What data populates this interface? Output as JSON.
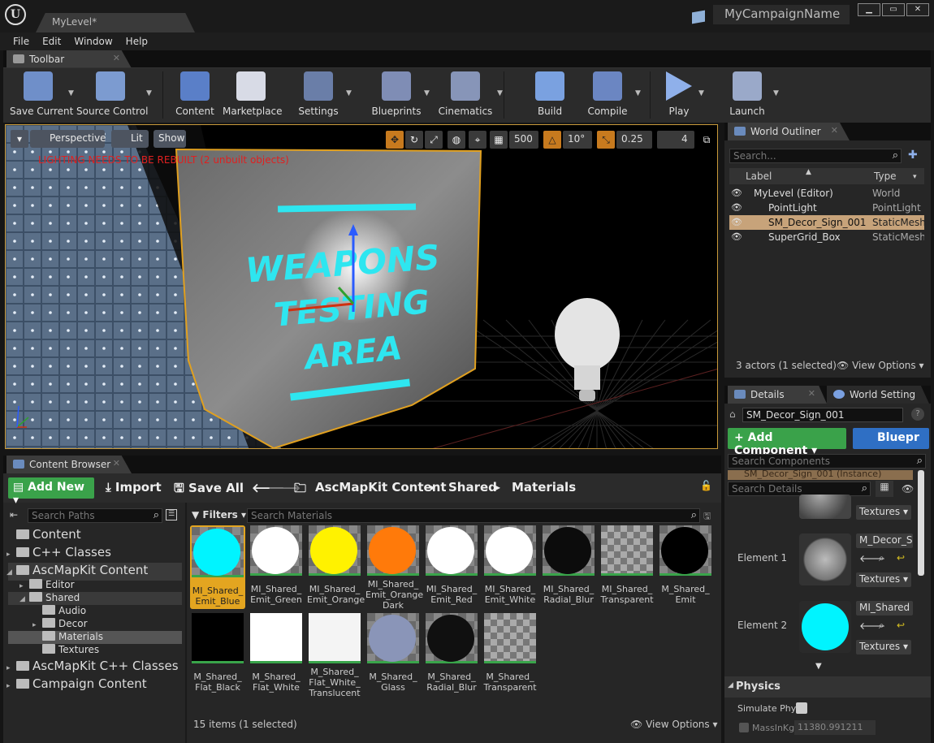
{
  "app": {
    "doc_tab": "MyLevel*",
    "campaign": "MyCampaignName",
    "win_buttons": [
      "▁",
      "▭",
      "✕"
    ]
  },
  "menu": [
    "File",
    "Edit",
    "Window",
    "Help"
  ],
  "toolbar_tab": "Toolbar",
  "toolbar": [
    {
      "label": "Save Current",
      "icon": "save-icon",
      "color": "#6f8fc9"
    },
    {
      "label": "Source Control",
      "icon": "source-control-icon",
      "color": "#7c9bd0"
    },
    {
      "label": "Content",
      "icon": "content-icon",
      "color": "#5a7fc8"
    },
    {
      "label": "Marketplace",
      "icon": "marketplace-icon",
      "color": "#d8dbe6"
    },
    {
      "label": "Settings",
      "icon": "settings-icon",
      "color": "#6a7ea8"
    },
    {
      "label": "Blueprints",
      "icon": "blueprints-icon",
      "color": "#7f8db5"
    },
    {
      "label": "Cinematics",
      "icon": "cinematics-icon",
      "color": "#8795b8"
    },
    {
      "label": "Build",
      "icon": "build-icon",
      "color": "#7aa1e0"
    },
    {
      "label": "Compile",
      "icon": "compile-icon",
      "color": "#6b86c2"
    },
    {
      "label": "Play",
      "icon": "play-icon",
      "color": "#8fb0ea"
    },
    {
      "label": "Launch",
      "icon": "launch-icon",
      "color": "#9aa9c9"
    }
  ],
  "viewport": {
    "perspective": "Perspective",
    "lit": "Lit",
    "show": "Show",
    "grid_snap": "500",
    "rot_snap": "10°",
    "scale_snap": "0.25",
    "cam_speed": "4",
    "warning": "LIGHTING NEEDS TO BE REBUILT (2 unbuilt objects)",
    "sign_lines": [
      "WEAPONS",
      "TESTING",
      "AREA"
    ]
  },
  "outliner": {
    "tab": "World Outliner",
    "search_placeholder": "Search...",
    "col_label": "Label",
    "col_type": "Type",
    "rows": [
      {
        "label": "MyLevel (Editor)",
        "type": "World",
        "indent": 0
      },
      {
        "label": "PointLight",
        "type": "PointLight",
        "indent": 1
      },
      {
        "label": "SM_Decor_Sign_001",
        "type": "StaticMeshActor",
        "indent": 1
      },
      {
        "label": "SuperGrid_Box",
        "type": "StaticMeshActor",
        "indent": 1
      }
    ],
    "status": "3 actors (1 selected)",
    "view_options": "View Options"
  },
  "details": {
    "tab": "Details",
    "tab2": "World Setting",
    "actor_name": "SM_Decor_Sign_001",
    "add_component": "+ Add Component",
    "blueprint": "Bluepr",
    "search_components": "Search Components",
    "component_row": "SM_Decor_Sign_001 (Instance)",
    "search_details": "Search Details",
    "textures": "Textures",
    "element1": "Element 1",
    "element1_mat": "M_Decor_S",
    "element2": "Element 2",
    "element2_mat": "MI_Shared",
    "physics": "Physics",
    "simulate": "Simulate Phy",
    "mass": "MassInKg",
    "mass_value": "11380.991211"
  },
  "content_browser": {
    "tab": "Content Browser",
    "add_new": "Add New",
    "import": "Import",
    "save_all": "Save All",
    "path": [
      "AscMapKit Content",
      "Shared",
      "Materials"
    ],
    "search_paths": "Search Paths",
    "filters": "Filters",
    "search_materials": "Search Materials",
    "tree": [
      {
        "label": "Content",
        "indent": 0,
        "big": true
      },
      {
        "label": "C++ Classes",
        "indent": 0,
        "big": true
      },
      {
        "label": "AscMapKit Content",
        "indent": 0,
        "big": true
      },
      {
        "label": "Editor",
        "indent": 1,
        "big": false
      },
      {
        "label": "Shared",
        "indent": 1,
        "big": false
      },
      {
        "label": "Audio",
        "indent": 2,
        "big": false
      },
      {
        "label": "Decor",
        "indent": 2,
        "big": false
      },
      {
        "label": "Materials",
        "indent": 2,
        "big": false
      },
      {
        "label": "Textures",
        "indent": 2,
        "big": false
      },
      {
        "label": "AscMapKit C++ Classes",
        "indent": 0,
        "big": true
      },
      {
        "label": "Campaign Content",
        "indent": 0,
        "big": true
      }
    ],
    "assets": [
      {
        "name": [
          "MI_Shared_",
          "Emit_Blue"
        ],
        "color": "#00f4ff",
        "kind": "ball"
      },
      {
        "name": [
          "MI_Shared_",
          "Emit_Green"
        ],
        "color": "#ffffff",
        "kind": "ball"
      },
      {
        "name": [
          "MI_Shared_",
          "Emit_Orange"
        ],
        "color": "#fff200",
        "kind": "ball"
      },
      {
        "name": [
          "MI_Shared_",
          "Emit_Orange",
          "Dark"
        ],
        "color": "#ff7a0a",
        "kind": "ball"
      },
      {
        "name": [
          "MI_Shared_",
          "Emit_Red"
        ],
        "color": "#ffffff",
        "kind": "ball"
      },
      {
        "name": [
          "MI_Shared_",
          "Emit_White"
        ],
        "color": "#ffffff",
        "kind": "ball"
      },
      {
        "name": [
          "MI_Shared_",
          "Radial_Blur"
        ],
        "color": "#0c0c0c",
        "kind": "ball"
      },
      {
        "name": [
          "MI_Shared_",
          "Transparent"
        ],
        "color": "",
        "kind": "checker"
      },
      {
        "name": [
          "M_Shared_",
          "Emit"
        ],
        "color": "#000000",
        "kind": "ball"
      },
      {
        "name": [
          "M_Shared_",
          "Flat_Black"
        ],
        "color": "#000000",
        "kind": "flat"
      },
      {
        "name": [
          "M_Shared_",
          "Flat_White"
        ],
        "color": "#ffffff",
        "kind": "flat"
      },
      {
        "name": [
          "M_Shared_",
          "Flat_White_",
          "Translucent"
        ],
        "color": "#f4f4f4",
        "kind": "flat"
      },
      {
        "name": [
          "M_Shared_",
          "Glass"
        ],
        "color": "#8a95b8",
        "kind": "ball"
      },
      {
        "name": [
          "M_Shared_",
          "Radial_Blur"
        ],
        "color": "#101010",
        "kind": "ball"
      },
      {
        "name": [
          "M_Shared_",
          "Transparent"
        ],
        "color": "",
        "kind": "checker"
      }
    ],
    "status": "15 items (1 selected)",
    "view_options": "View Options"
  }
}
